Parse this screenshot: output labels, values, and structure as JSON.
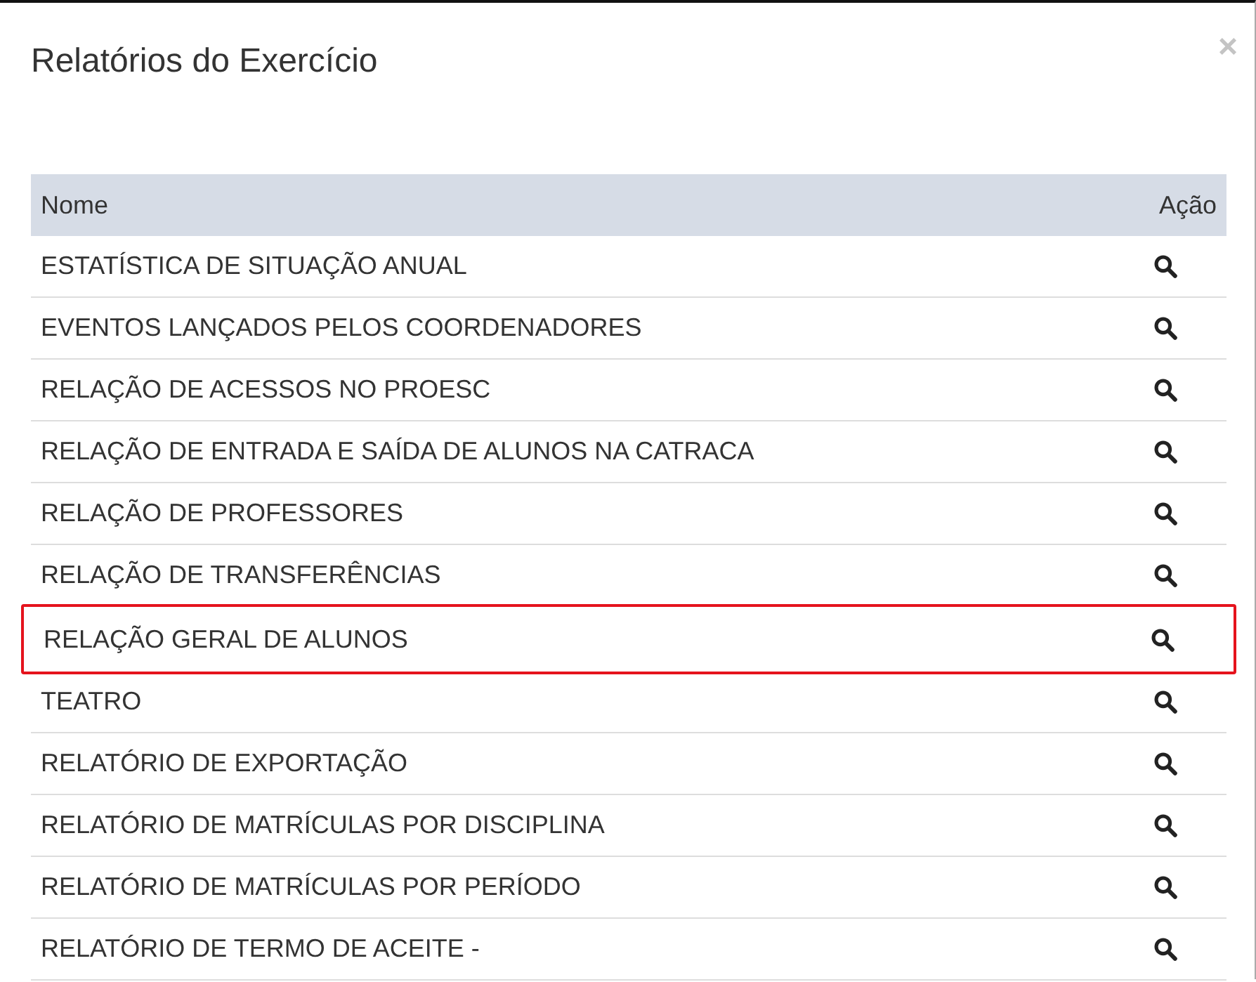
{
  "dialog": {
    "title": "Relatórios do Exercício",
    "close": "×"
  },
  "table": {
    "columns": [
      "Nome",
      "Ação"
    ],
    "rows": [
      {
        "name": "ESTATÍSTICA DE SITUAÇÃO ANUAL",
        "highlighted": false
      },
      {
        "name": "EVENTOS LANÇADOS PELOS COORDENADORES",
        "highlighted": false
      },
      {
        "name": "RELAÇÃO DE ACESSOS NO PROESC",
        "highlighted": false
      },
      {
        "name": "RELAÇÃO DE ENTRADA E SAÍDA DE ALUNOS NA CATRACA",
        "highlighted": false
      },
      {
        "name": "RELAÇÃO DE PROFESSORES",
        "highlighted": false
      },
      {
        "name": "RELAÇÃO DE TRANSFERÊNCIAS",
        "highlighted": false
      },
      {
        "name": "RELAÇÃO GERAL DE ALUNOS",
        "highlighted": true
      },
      {
        "name": "TEATRO",
        "highlighted": false
      },
      {
        "name": "RELATÓRIO DE EXPORTAÇÃO",
        "highlighted": false
      },
      {
        "name": "RELATÓRIO DE MATRÍCULAS POR DISCIPLINA",
        "highlighted": false
      },
      {
        "name": "RELATÓRIO DE MATRÍCULAS POR PERÍODO",
        "highlighted": false
      },
      {
        "name": "RELATÓRIO DE TERMO DE ACEITE -",
        "highlighted": false
      }
    ]
  }
}
